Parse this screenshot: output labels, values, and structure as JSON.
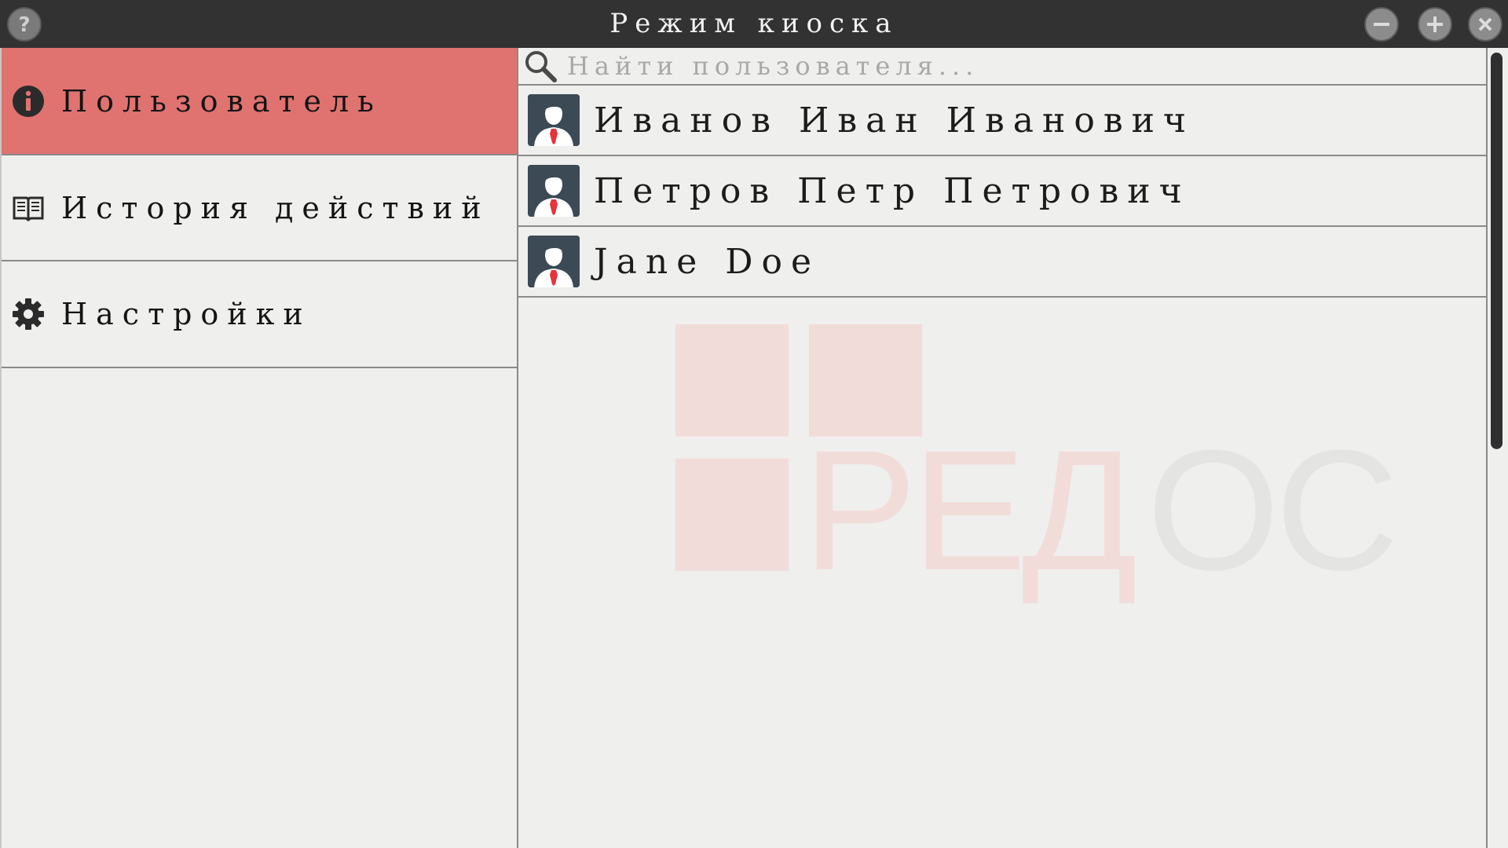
{
  "window": {
    "title": "Режим киоска",
    "buttons": {
      "help": "help-icon",
      "minimize": "minus-icon",
      "maximize": "plus-icon",
      "close": "close-icon"
    }
  },
  "sidebar": {
    "items": [
      {
        "label": "Пользователь",
        "icon": "info-icon",
        "active": true
      },
      {
        "label": "История действий",
        "icon": "book-icon",
        "active": false
      },
      {
        "label": "Настройки",
        "icon": "gear-icon",
        "active": false
      }
    ]
  },
  "search": {
    "placeholder": "Найти пользователя...",
    "value": ""
  },
  "users": [
    {
      "name": "Иванов Иван Иванович"
    },
    {
      "name": "Петров Петр Петрович"
    },
    {
      "name": "Jane Doe"
    }
  ],
  "watermark": {
    "text": "РЕДОС"
  },
  "colors": {
    "titlebar": "#323232",
    "active_item": "#e07270",
    "background": "#efefed",
    "avatar_bg": "#3b4a54",
    "tie": "#e8323c"
  }
}
